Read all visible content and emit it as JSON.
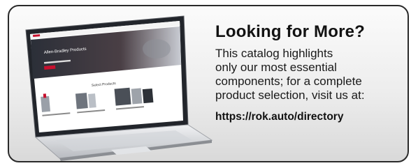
{
  "promo": {
    "heading": "Looking for More?",
    "body": "This catalog highlights\nonly our most essential\ncomponents; for a complete\nproduct selection, visit us at:",
    "url": "https://rok.auto/directory"
  },
  "laptop_screen": {
    "hero_title": "Allen-Bradley Products",
    "section_title": "Select Products"
  },
  "colors": {
    "accent": "#c8102e",
    "text": "#121212"
  }
}
